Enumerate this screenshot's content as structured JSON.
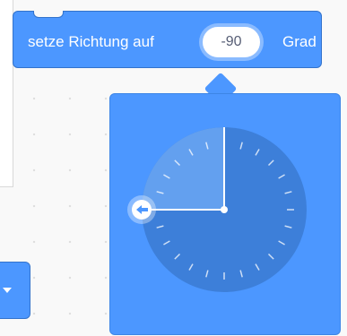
{
  "block": {
    "text_before": "setze Richtung auf",
    "value": "-90",
    "text_after": "Grad",
    "color": "#4c97ff"
  },
  "dial": {
    "direction_degrees": -90,
    "tick_count": 24
  },
  "icons": {
    "handle": "arrow-left-icon",
    "dropdown": "caret-down-icon"
  }
}
